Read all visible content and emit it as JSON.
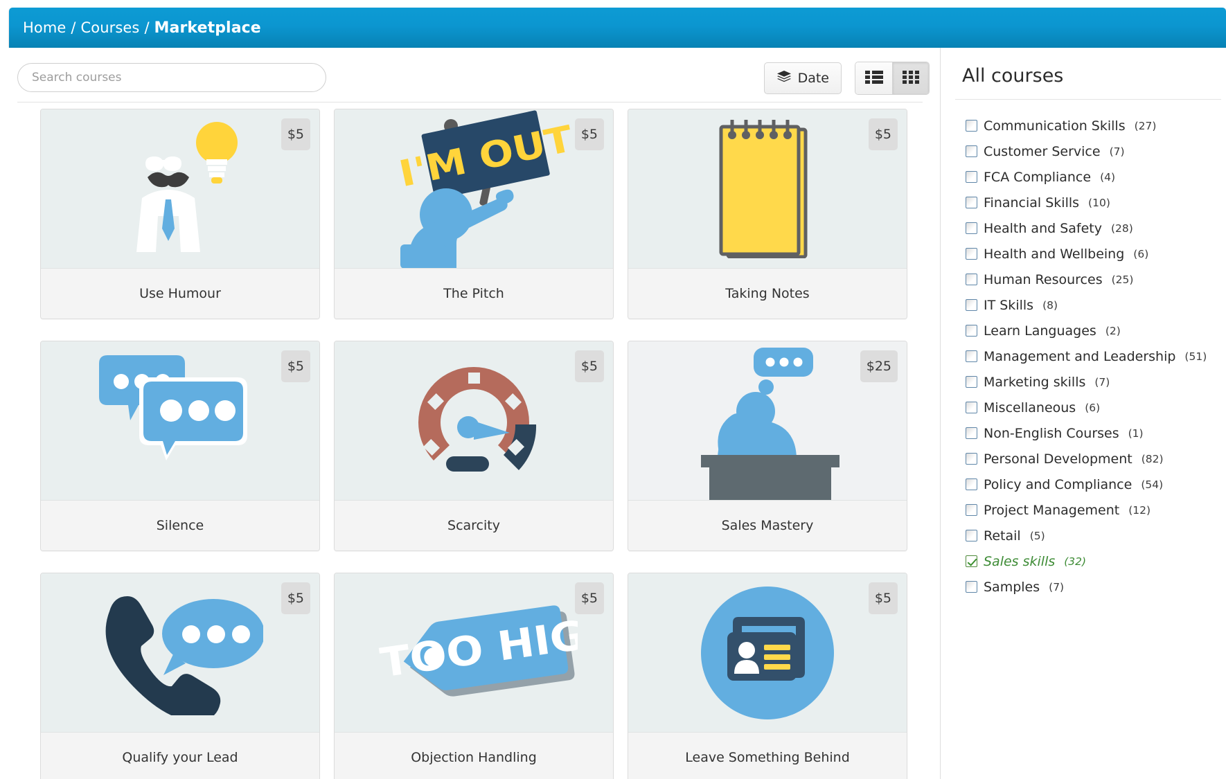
{
  "breadcrumb": {
    "items": [
      "Home",
      "Courses"
    ],
    "separator": "/",
    "current": "Marketplace"
  },
  "toolbar": {
    "search_placeholder": "Search courses",
    "search_value": "",
    "sort_label": "Date",
    "sort_icon": "layers-icon",
    "list_view_icon": "list-view-icon",
    "grid_view_icon": "grid-view-icon",
    "active_view": "grid"
  },
  "courses": [
    {
      "title": "Use Humour",
      "price": "$5",
      "icon": "mustache-man-lightbulb-icon",
      "bg": "#e9efef"
    },
    {
      "title": "The Pitch",
      "price": "$5",
      "icon": "protest-sign-im-out-icon",
      "bg": "#e9efef"
    },
    {
      "title": "Taking Notes",
      "price": "$5",
      "icon": "yellow-notepad-icon",
      "bg": "#e9efef"
    },
    {
      "title": "Silence",
      "price": "$5",
      "icon": "two-speech-bubbles-icon",
      "bg": "#e9efef"
    },
    {
      "title": "Scarcity",
      "price": "$5",
      "icon": "speedometer-gauge-icon",
      "bg": "#e9efef"
    },
    {
      "title": "Sales Mastery",
      "price": "$25",
      "icon": "person-at-desk-thinking-icon",
      "bg": "#f0f2f3"
    },
    {
      "title": "Qualify your Lead",
      "price": "$5",
      "icon": "phone-speech-bubble-icon",
      "bg": "#e9efef"
    },
    {
      "title": "Objection Handling",
      "price": "$5",
      "icon": "price-tag-too-high-icon",
      "bg": "#e9efef"
    },
    {
      "title": "Leave Something Behind",
      "price": "$5",
      "icon": "id-business-card-icon",
      "bg": "#e9efef"
    }
  ],
  "sidebar": {
    "title": "All courses",
    "facets": [
      {
        "label": "Communication Skills",
        "count": "(27)",
        "checked": false
      },
      {
        "label": "Customer Service",
        "count": "(7)",
        "checked": false
      },
      {
        "label": "FCA Compliance",
        "count": "(4)",
        "checked": false
      },
      {
        "label": "Financial Skills",
        "count": "(10)",
        "checked": false
      },
      {
        "label": "Health and Safety",
        "count": "(28)",
        "checked": false
      },
      {
        "label": "Health and Wellbeing",
        "count": "(6)",
        "checked": false
      },
      {
        "label": "Human Resources",
        "count": "(25)",
        "checked": false
      },
      {
        "label": "IT Skills",
        "count": "(8)",
        "checked": false
      },
      {
        "label": "Learn Languages",
        "count": "(2)",
        "checked": false
      },
      {
        "label": "Management and Leadership",
        "count": "(51)",
        "checked": false
      },
      {
        "label": "Marketing skills",
        "count": "(7)",
        "checked": false
      },
      {
        "label": "Miscellaneous",
        "count": "(6)",
        "checked": false
      },
      {
        "label": "Non-English Courses",
        "count": "(1)",
        "checked": false
      },
      {
        "label": "Personal Development",
        "count": "(82)",
        "checked": false
      },
      {
        "label": "Policy and Compliance",
        "count": "(54)",
        "checked": false
      },
      {
        "label": "Project Management",
        "count": "(12)",
        "checked": false
      },
      {
        "label": "Retail",
        "count": "(5)",
        "checked": false
      },
      {
        "label": "Sales skills",
        "count": "(32)",
        "checked": true
      },
      {
        "label": "Samples",
        "count": "(7)",
        "checked": false
      }
    ]
  },
  "colors": {
    "header_blue_top": "#0d9bd4",
    "header_blue_bottom": "#0782b4",
    "accent_blue": "#65b2e8",
    "accent_yellow": "#ffd943",
    "accent_navy": "#2c4459",
    "selected_green": "#3d8b35"
  }
}
